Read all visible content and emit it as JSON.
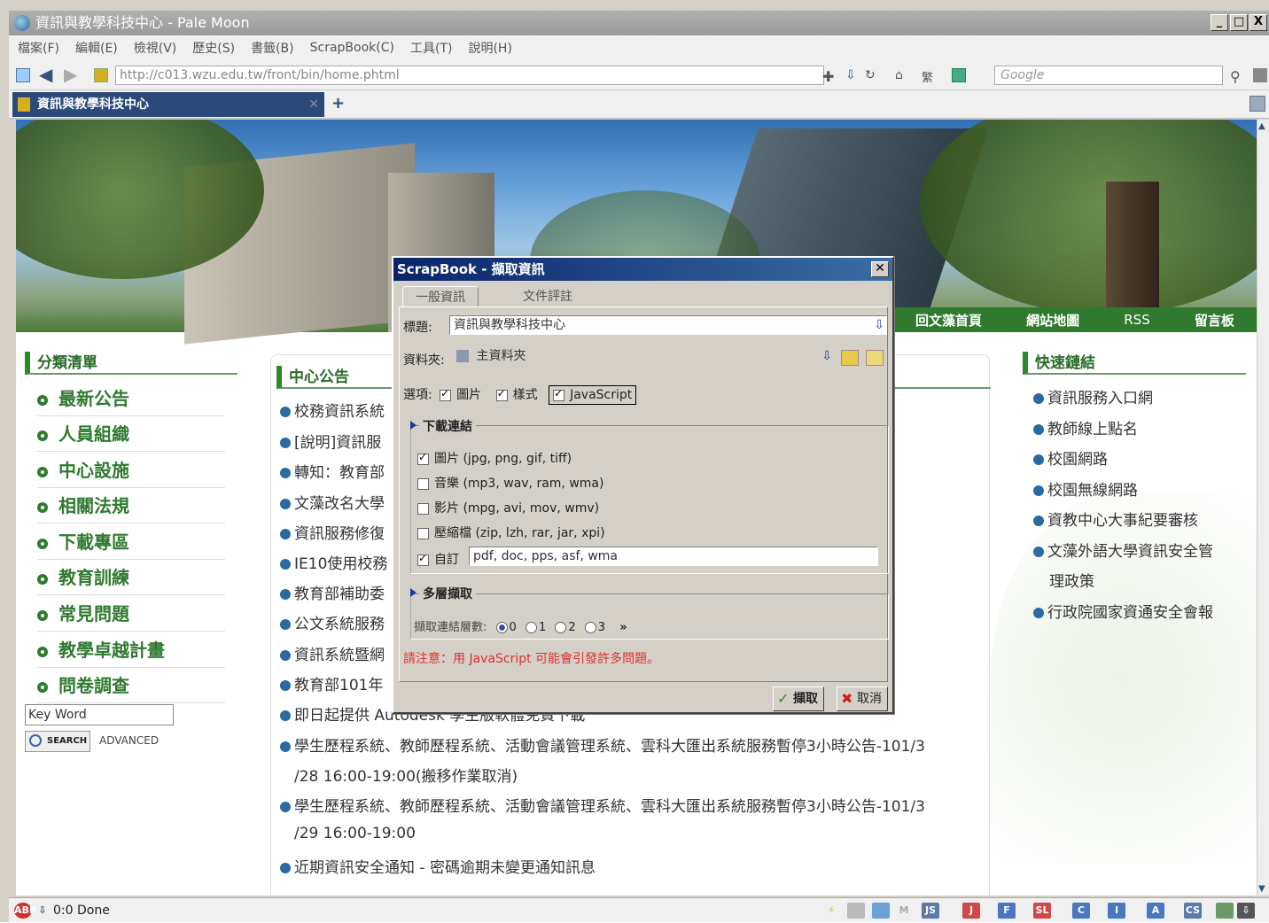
{
  "window": {
    "title": "資訊與教學科技中心 - Pale Moon",
    "buttons": [
      "_",
      "□",
      "X"
    ]
  },
  "menubar": [
    "檔案(F)",
    "編輯(E)",
    "檢視(V)",
    "歷史(S)",
    "書籤(B)",
    "ScrapBook(C)",
    "工具(T)",
    "說明(H)"
  ],
  "navbar": {
    "url": "http://c013.wzu.edu.tw/front/bin/home.phtml",
    "search_placeholder": "Google"
  },
  "tabs": [
    {
      "label": "資訊與教學科技中心"
    }
  ],
  "banner_nav": [
    "回文藻首頁",
    "網站地圖",
    "RSS",
    "留言板"
  ],
  "sidebar": {
    "heading": "分類清單",
    "items": [
      "最新公告",
      "人員組織",
      "中心設施",
      "相關法規",
      "下載專區",
      "教育訓練",
      "常見問題",
      "教學卓越計畫",
      "問卷調查"
    ],
    "keyword": "Key Word",
    "search_label": "SEARCH",
    "advanced_label": "ADVANCED"
  },
  "news": {
    "heading": "中心公告",
    "items": [
      "校務資訊系統",
      "[說明]資訊服",
      "轉知：教育部",
      "文藻改名大學",
      "資訊服務修復",
      "IE10使用校務",
      "教育部補助委",
      "公文系統服務",
      "資訊系統暨網",
      "教育部101年",
      "即日起提供 Autodesk 學生版軟體免費下載",
      "學生歷程系統、教師歷程系統、活動會議管理系統、雲科大匯出系統服務暫停3小時公告-101/3",
      "/28 16:00-19:00(搬移作業取消)",
      "學生歷程系統、教師歷程系統、活動會議管理系統、雲科大匯出系統服務暫停3小時公告-101/3",
      "/29 16:00-19:00",
      "近期資訊安全通知 - 密碼逾期未變更通知訊息"
    ]
  },
  "quicklinks": {
    "heading": "快速鏈結",
    "items": [
      "資訊服務入口網",
      "教師線上點名",
      "校園網路",
      "校園無線網路",
      "資教中心大事紀要審核",
      "文藻外語大學資訊安全管",
      "理政策",
      "行政院國家資通安全會報"
    ]
  },
  "dialog": {
    "title": "ScrapBook - 擷取資訊",
    "tabs": [
      "一般資訊",
      "文件評註"
    ],
    "title_label": "標題:",
    "title_value": "資訊與教學科技中心",
    "folder_label": "資料夾:",
    "folder_value": "主資料夾",
    "options_label": "選項:",
    "options": [
      {
        "label": "圖片",
        "checked": true
      },
      {
        "label": "樣式",
        "checked": true
      },
      {
        "label": "JavaScript",
        "checked": true
      }
    ],
    "download_heading": "下載連結",
    "downloads": [
      {
        "label": "圖片 (jpg, png, gif, tiff)",
        "checked": true
      },
      {
        "label": "音樂 (mp3, wav, ram, wma)",
        "checked": false
      },
      {
        "label": "影片 (mpg, avi, mov, wmv)",
        "checked": false
      },
      {
        "label": "壓縮檔 (zip, lzh, rar, jar, xpi)",
        "checked": false
      },
      {
        "label": "自訂",
        "checked": true
      }
    ],
    "custom_value": "pdf, doc, pps, asf, wma",
    "multi_heading": "多層擷取",
    "depth_label": "擷取連結層數:",
    "depth_options": [
      "0",
      "1",
      "2",
      "3"
    ],
    "depth_selected": "0",
    "more": "»",
    "warning": "請注意：用 JavaScript 可能會引發許多問題。",
    "ok_label": "擷取",
    "cancel_label": "取消"
  },
  "statusbar": {
    "text": "0:0 Done",
    "icons": [
      "JS",
      "J",
      "F",
      "SL",
      "C",
      "I",
      "A",
      "CS"
    ]
  },
  "colors": {
    "accent_green": "#2f7a2f",
    "dialog_title": "#0a246a",
    "warning": "#e03030"
  }
}
